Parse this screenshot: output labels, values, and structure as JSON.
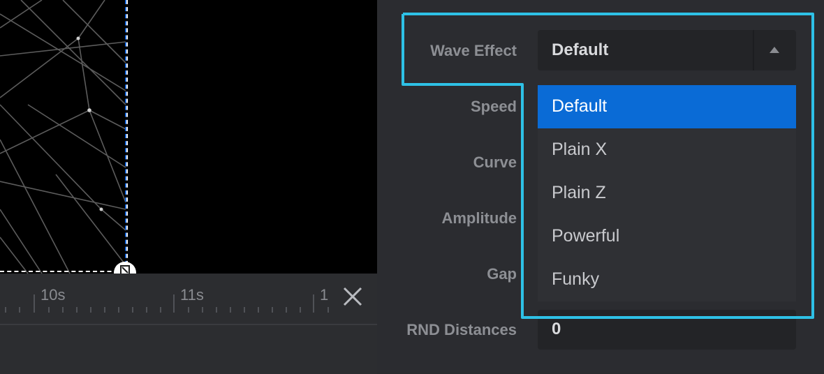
{
  "timeline": {
    "ticks": [
      "10s",
      "11s",
      "1"
    ]
  },
  "panel": {
    "wave_effect": {
      "label": "Wave Effect",
      "value": "Default",
      "options": [
        "Default",
        "Plain X",
        "Plain Z",
        "Powerful",
        "Funky"
      ],
      "selected_index": 0
    },
    "labels": {
      "speed": "Speed",
      "curve": "Curve",
      "amplitude": "Amplitude",
      "gap": "Gap",
      "rnd_distances": "RND Distances"
    },
    "rnd_distances_value": "0"
  },
  "colors": {
    "selected_option": "#0a6bd6",
    "highlight_outline": "#2ec1e6",
    "selection_dash": "#1565d8"
  },
  "icons": {
    "close": "close-icon",
    "resize": "resize-handle-icon",
    "dropdown_arrow": "triangle-up-icon"
  }
}
